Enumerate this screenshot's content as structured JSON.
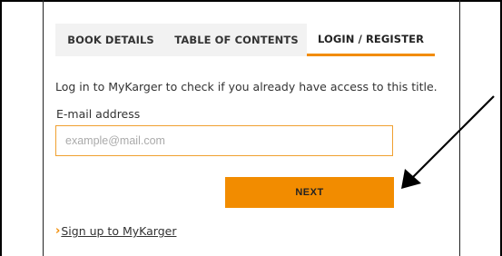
{
  "tabs": [
    {
      "label": "BOOK DETAILS"
    },
    {
      "label": "TABLE OF CONTENTS"
    },
    {
      "label": "LOGIN / REGISTER"
    }
  ],
  "active_tab": "LOGIN / REGISTER",
  "login": {
    "intro_text": "Log in to MyKarger to check if you already have access to this title.",
    "email_label": "E-mail address",
    "email_value": "",
    "email_placeholder": "example@mail.com",
    "next_label": "NEXT",
    "signup_label": "Sign up to MyKarger"
  },
  "colors": {
    "accent": "#f28c00",
    "tab_bar_bg": "#f2f2f2",
    "input_border": "#f0a030",
    "text": "#333333"
  },
  "icons": {
    "signup_chevron": "chevron-right-icon",
    "annotation": "annotation-arrow-icon"
  }
}
